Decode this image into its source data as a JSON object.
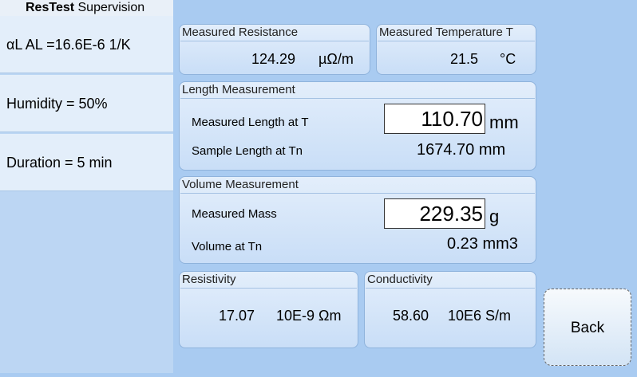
{
  "window": {
    "title_bold": "ResTest",
    "title_rest": " Supervision"
  },
  "sidebar": {
    "items": [
      {
        "label": "αL AL =16.6E-6 1/K"
      },
      {
        "label": "Humidity = 50%"
      },
      {
        "label": "Duration = 5 min"
      }
    ]
  },
  "measured_resistance": {
    "title": "Measured Resistance",
    "value": "124.29",
    "unit": "µΩ/m"
  },
  "measured_temperature": {
    "title": "Measured Temperature T",
    "value": "21.5",
    "unit": "°C"
  },
  "length": {
    "title": "Length Measurement",
    "measured_label": "Measured Length at T",
    "measured_value": "110.70",
    "measured_unit": "mm",
    "sample_label": "Sample Length at Tn",
    "sample_value": "1674.70 mm"
  },
  "volume": {
    "title": "Volume Measurement",
    "mass_label": "Measured Mass",
    "mass_value": "229.35",
    "mass_unit": "g",
    "volume_label": "Volume at Tn",
    "volume_value": "0.23 mm3"
  },
  "resistivity": {
    "title": "Resistivity",
    "value": "17.07",
    "unit": "10E-9 Ωm"
  },
  "conductivity": {
    "title": "Conductivity",
    "value": "58.60",
    "unit": "10E6 S/m"
  },
  "back_button": {
    "label": "Back"
  },
  "colors": {
    "background": "#a9cbf1",
    "panel": "#e3eefb",
    "panel_border": "#8fb3dc"
  }
}
